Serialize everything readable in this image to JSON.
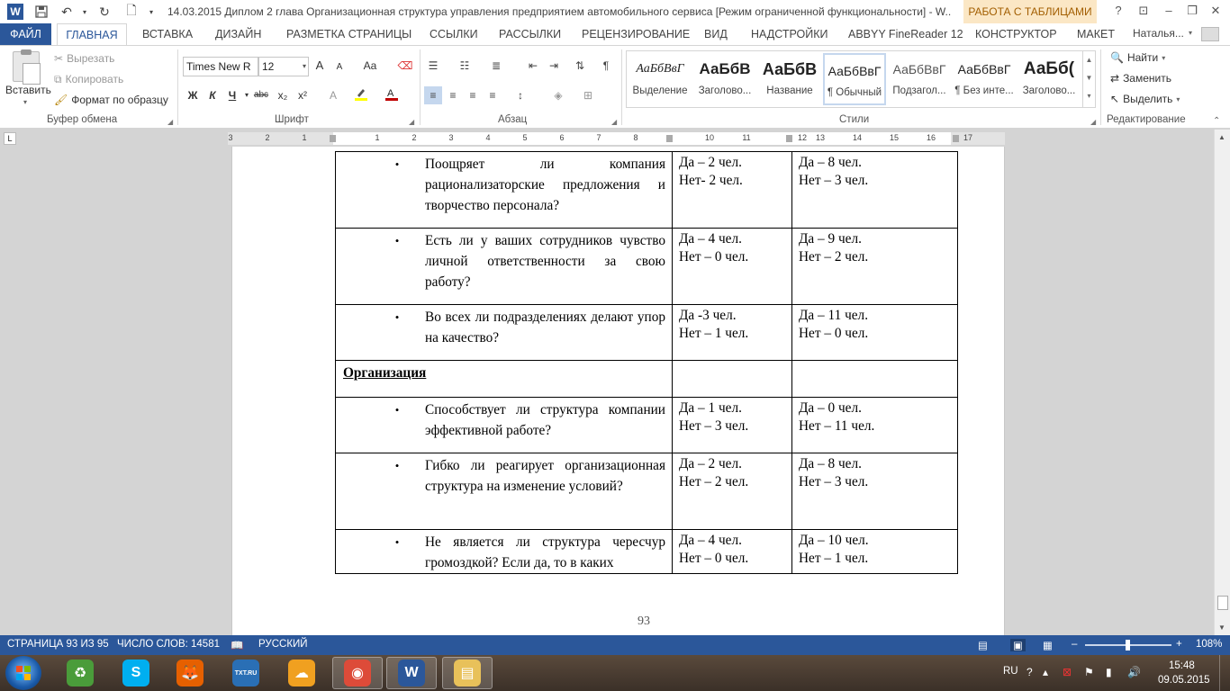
{
  "window": {
    "title": "14.03.2015 Диплом 2 глава Организационная структура управления предприятием автомобильного сервиса [Режим ограниченной функциональности] - W...",
    "contextual_tab_group": "РАБОТА С ТАБЛИЦАМИ",
    "controls": {
      "help": "?",
      "restore": "⊡",
      "minimize": "–",
      "maximize": "❐",
      "close": "✕"
    }
  },
  "quick_access": {
    "logo": "W",
    "save_icon": "save-icon",
    "undo_icon": "undo-icon",
    "redo_icon": "redo-icon",
    "new_icon": "new-doc-icon"
  },
  "tabs": [
    {
      "label": "ФАЙЛ"
    },
    {
      "label": "ГЛАВНАЯ"
    },
    {
      "label": "ВСТАВКА"
    },
    {
      "label": "ДИЗАЙН"
    },
    {
      "label": "РАЗМЕТКА СТРАНИЦЫ"
    },
    {
      "label": "ССЫЛКИ"
    },
    {
      "label": "РАССЫЛКИ"
    },
    {
      "label": "РЕЦЕНЗИРОВАНИЕ"
    },
    {
      "label": "ВИД"
    },
    {
      "label": "НАДСТРОЙКИ"
    },
    {
      "label": "ABBYY FineReader 12"
    },
    {
      "label": "КОНСТРУКТОР"
    },
    {
      "label": "МАКЕТ"
    }
  ],
  "account": "Наталья...",
  "clipboard": {
    "paste": "Вставить",
    "cut": "Вырезать",
    "copy": "Копировать",
    "format_painter": "Формат по образцу",
    "group": "Буфер обмена"
  },
  "font": {
    "name": "Times New R",
    "size": "12",
    "group": "Шрифт",
    "bold": "Ж",
    "italic": "К",
    "underline": "Ч",
    "strike": "abc",
    "subscript": "x₂",
    "superscript": "x²",
    "grow": "A",
    "shrink": "A",
    "case": "Aa",
    "highlight_color": "#ffff00",
    "font_color": "#c00000"
  },
  "paragraph": {
    "group": "Абзац",
    "pilcrow": "¶"
  },
  "styles": {
    "group": "Стили",
    "items": [
      {
        "preview": "АаБбВвГ",
        "name": "Выделение"
      },
      {
        "preview": "АаБбВ",
        "name": "Заголово..."
      },
      {
        "preview": "АаБбВ",
        "name": "Название"
      },
      {
        "preview": "АаБбВвГ",
        "name": "¶ Обычный"
      },
      {
        "preview": "АаБбВвГ",
        "name": "Подзагол..."
      },
      {
        "preview": "АаБбВвГ",
        "name": "¶ Без инте..."
      },
      {
        "preview": "АаБб(",
        "name": "Заголово..."
      }
    ]
  },
  "editing": {
    "find": "Найти",
    "replace": "Заменить",
    "select": "Выделить",
    "group": "Редактирование"
  },
  "ruler": {
    "tab_selector": "L",
    "numbers": [
      "3",
      "2",
      "1",
      "1",
      "2",
      "3",
      "4",
      "5",
      "6",
      "7",
      "8",
      "10",
      "11",
      "12",
      "13",
      "14",
      "15",
      "16",
      "17"
    ]
  },
  "document": {
    "rows": [
      {
        "type": "q",
        "text": "Поощряет ли компания рационализаторские предложения и творчество персонала?",
        "a": [
          "Да – 2 чел.",
          "Нет- 2 чел."
        ],
        "b": [
          "Да – 8 чел.",
          "Нет – 3 чел."
        ]
      },
      {
        "type": "q",
        "text": "Есть ли у ваших сотрудников чувство личной ответственности за свою работу?",
        "a": [
          "Да – 4 чел.",
          "Нет – 0 чел."
        ],
        "b": [
          "Да – 9 чел.",
          "Нет – 2 чел."
        ]
      },
      {
        "type": "q",
        "text": "Во всех ли подразделениях делают упор на качество?",
        "a": [
          "Да -3 чел.",
          "Нет – 1 чел."
        ],
        "b": [
          "Да – 11 чел.",
          "Нет – 0 чел."
        ]
      },
      {
        "type": "section",
        "text": "Организация"
      },
      {
        "type": "q",
        "text": "Способствует ли структура компании эффективной работе?",
        "a": [
          "Да – 1 чел.",
          "Нет – 3 чел."
        ],
        "b": [
          "Да – 0 чел.",
          "Нет – 11 чел."
        ]
      },
      {
        "type": "q",
        "text": "Гибко ли реагирует организационная структура на изменение условий?",
        "a": [
          "Да – 2 чел.",
          "Нет – 2 чел."
        ],
        "b": [
          "Да – 8 чел.",
          "Нет – 3 чел."
        ]
      },
      {
        "type": "q",
        "text": "Не является ли структура чересчур громоздкой? Если да, то в каких",
        "a": [
          "Да – 4 чел.",
          "Нет – 0 чел."
        ],
        "b": [
          "Да – 10 чел.",
          "Нет – 1 чел."
        ]
      }
    ],
    "page_number": "93"
  },
  "status": {
    "page": "СТРАНИЦА 93 ИЗ 95",
    "words": "ЧИСЛО СЛОВ: 14581",
    "language": "РУССКИЙ",
    "zoom": "108%",
    "zoom_minus": "–",
    "zoom_plus": "+"
  },
  "taskbar": {
    "apps": [
      {
        "name": "recycle-bin",
        "label": "♻",
        "color": "#4a9c3a"
      },
      {
        "name": "skype",
        "label": "S",
        "color": "#00aff0"
      },
      {
        "name": "firefox",
        "label": "🦊",
        "color": "#e66000"
      },
      {
        "name": "txt-ru",
        "label": "TXT.RU",
        "color": "#2a6fb5"
      },
      {
        "name": "cloud-app",
        "label": "☁",
        "color": "#f0a020"
      },
      {
        "name": "chrome",
        "label": "◉",
        "color": "#dd4b39"
      },
      {
        "name": "word",
        "label": "W",
        "color": "#2b579a"
      },
      {
        "name": "explorer",
        "label": "▤",
        "color": "#e8c15a"
      }
    ],
    "lang": "RU",
    "time": "15:48",
    "date": "09.05.2015"
  }
}
